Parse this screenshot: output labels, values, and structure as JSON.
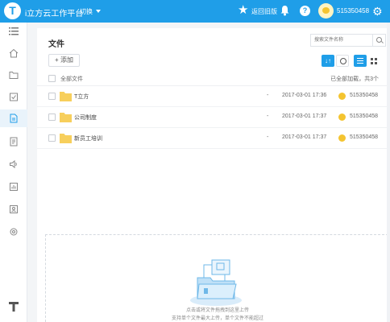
{
  "topbar": {
    "app_title": "i立方云工作平台",
    "workspace": "切换",
    "back_old": "返回旧版",
    "user_name": "515350458",
    "help_label": "?"
  },
  "sidebar": {
    "items": [
      {
        "name": "menu-icon"
      },
      {
        "name": "home-icon"
      },
      {
        "name": "folder-icon"
      },
      {
        "name": "task-icon"
      },
      {
        "name": "document-icon",
        "active": true
      },
      {
        "name": "notes-icon"
      },
      {
        "name": "speaker-icon"
      },
      {
        "name": "chart-icon"
      },
      {
        "name": "contacts-icon"
      },
      {
        "name": "settings-icon"
      }
    ]
  },
  "main": {
    "title": "文件",
    "search_placeholder": "搜索文件名称",
    "add_label": "+ 添加",
    "sort_label": "↓↑",
    "header_label": "全部文件",
    "header_count": "已全部加载，共3个",
    "files": [
      {
        "name": "T立方",
        "size": "-",
        "date": "2017-03-01 17:36",
        "owner": "515350458"
      },
      {
        "name": "公司制度",
        "size": "-",
        "date": "2017-03-01 17:37",
        "owner": "515350458"
      },
      {
        "name": "新员工培训",
        "size": "-",
        "date": "2017-03-01 17:37",
        "owner": "515350458"
      }
    ],
    "drop_line1": "点击或将文件拖拽到这里上传",
    "drop_line2": "支持单个文件最大上传，单个文件不能超过"
  },
  "colors": {
    "accent": "#1f9ee8",
    "folder": "#f7cf5c",
    "active_bg": "#e9f3fb"
  }
}
